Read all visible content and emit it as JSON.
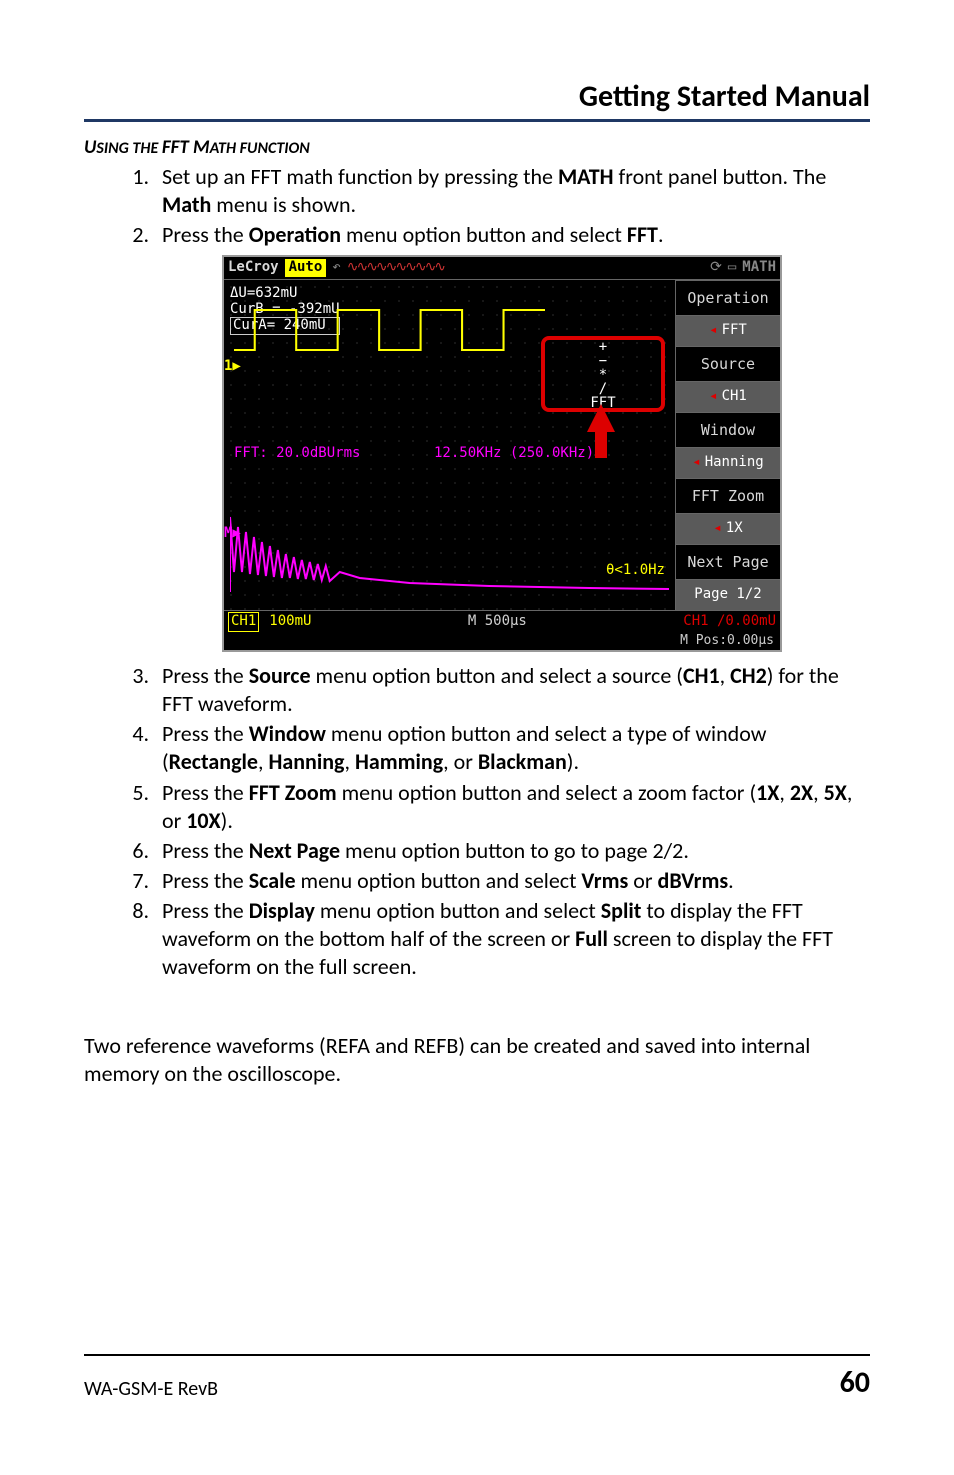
{
  "header": {
    "title": "Getting Started Manual"
  },
  "section": {
    "heading_html": "USING THE FFT MATH FUNCTION"
  },
  "steps": {
    "s1a": "Set up an FFT math function by pressing the ",
    "s1b": "MATH",
    "s1c": " front panel button. The ",
    "s1d": "Math",
    "s1e": " menu is shown.",
    "s2a": "Press the ",
    "s2b": "Operation",
    "s2c": " menu option button and select ",
    "s2d": "FFT",
    "s2e": ".",
    "s3a": "Press the ",
    "s3b": "Source",
    "s3c": " menu option button and select a source (",
    "s3d": "CH1",
    "s3e": ", ",
    "s3f": "CH2",
    "s3g": ") for the FFT waveform.",
    "s4a": "Press the ",
    "s4b": "Window",
    "s4c": " menu option button and select a type of window (",
    "s4d": "Rectangle",
    "s4e": ", ",
    "s4f": "Hanning",
    "s4g": ", ",
    "s4h": "Hamming",
    "s4i": ", or ",
    "s4j": "Blackman",
    "s4k": ").",
    "s5a": "Press the ",
    "s5b": "FFT Zoom",
    "s5c": " menu option button and select a zoom factor (",
    "s5d": "1X",
    "s5e": ", ",
    "s5f": "2X",
    "s5g": ", ",
    "s5h": "5X",
    "s5i": ", or ",
    "s5j": "10X",
    "s5k": ").",
    "s6a": "Press the ",
    "s6b": "Next Page",
    "s6c": " menu option button to go to page 2/2.",
    "s7a": "Press the ",
    "s7b": "Scale",
    "s7c": " menu option button and select ",
    "s7d": "Vrms",
    "s7e": " or ",
    "s7f": "dBVrms",
    "s7g": ".",
    "s8a": "Press the ",
    "s8b": "Display",
    "s8c": " menu option button and select ",
    "s8d": "Split",
    "s8e": " to display the FFT waveform on the bottom half of the screen or ",
    "s8f": "Full",
    "s8g": " screen to display the FFT waveform on the full screen."
  },
  "scope": {
    "brand": "LeCroy",
    "mode": "Auto",
    "menu_title": "MATH",
    "cursors": {
      "du": "ΔU=632mU",
      "curb": "CurB = -392mU",
      "cura": "CurA= 240mU"
    },
    "popup": {
      "line1": "+",
      "line2": "−",
      "line3": "*",
      "line4": "/",
      "line5": "FFT"
    },
    "side": {
      "operation": "Operation",
      "operation_val": "FFT",
      "source": "Source",
      "source_val": "CH1",
      "window": "Window",
      "window_val": "Hanning",
      "zoom": "FFT Zoom",
      "zoom_val": "1X",
      "next": "Next Page",
      "next_val": "Page 1/2"
    },
    "fft_label1": "FFT: 20.0dBUrms",
    "fft_label2": "12.50KHz (250.0KHz)",
    "hz": "θ<1.0Hz",
    "bottom": {
      "ch1": "CH1",
      "ch1_val": "100mU",
      "timebase": "M 500µs",
      "trig": "CH1 /0.00mU",
      "pos": "M Pos:0.00µs"
    }
  },
  "paragraph": "Two reference waveforms (REFA and REFB) can be created and saved into internal memory on the oscilloscope.",
  "footer": {
    "left": "WA-GSM-E RevB",
    "page": "60"
  }
}
